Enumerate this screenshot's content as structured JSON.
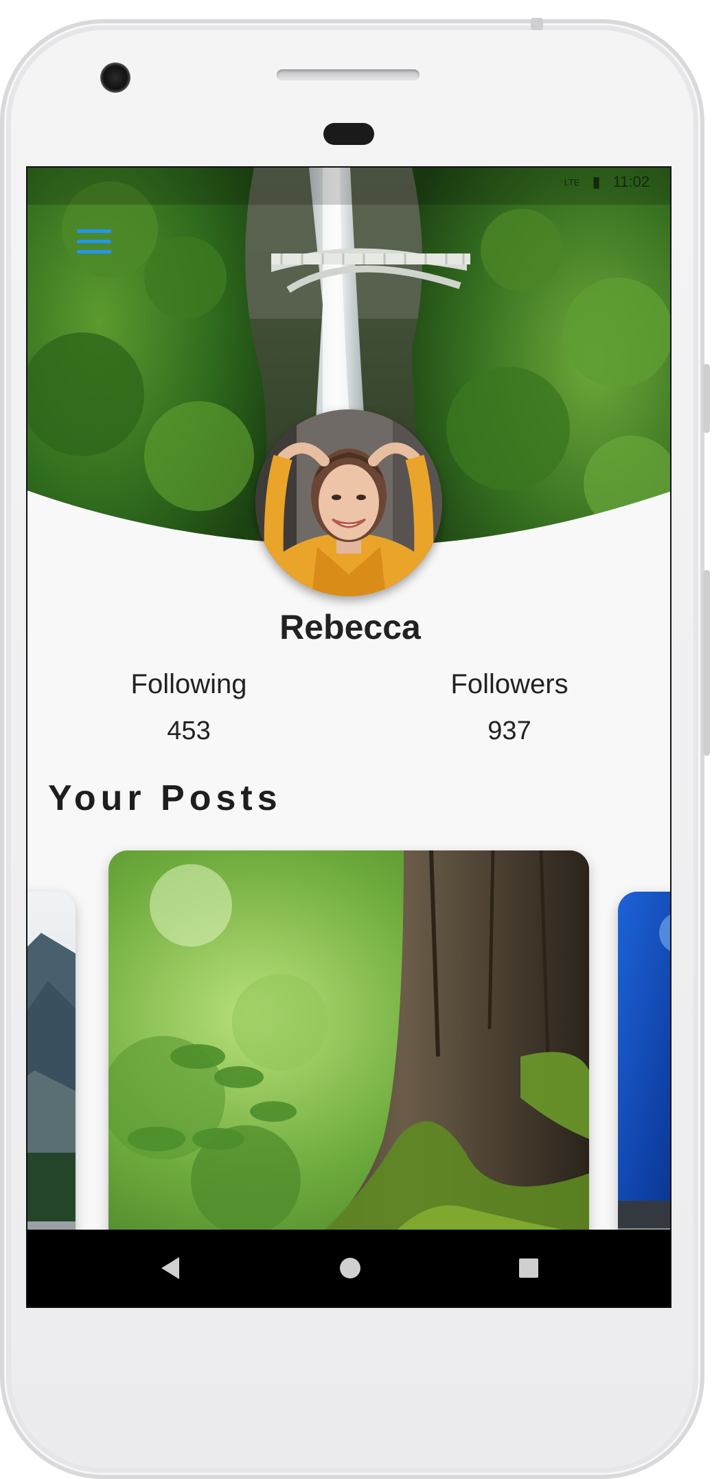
{
  "status_bar": {
    "network": "LTE",
    "time": "11:02"
  },
  "header": {
    "menu_icon": "hamburger-menu-icon",
    "accent_color": "#2196F3"
  },
  "profile": {
    "name": "Rebecca",
    "following_label": "Following",
    "following_count": "453",
    "followers_label": "Followers",
    "followers_count": "937"
  },
  "posts": {
    "title": "Your Posts",
    "cards": [
      {
        "subject": "mountain-landscape"
      },
      {
        "subject": "mossy-tree-trunk"
      },
      {
        "subject": "blue-abstract"
      }
    ]
  },
  "navigation": {
    "back_icon": "back-triangle-icon",
    "home_icon": "home-circle-icon",
    "recents_icon": "recents-square-icon"
  }
}
